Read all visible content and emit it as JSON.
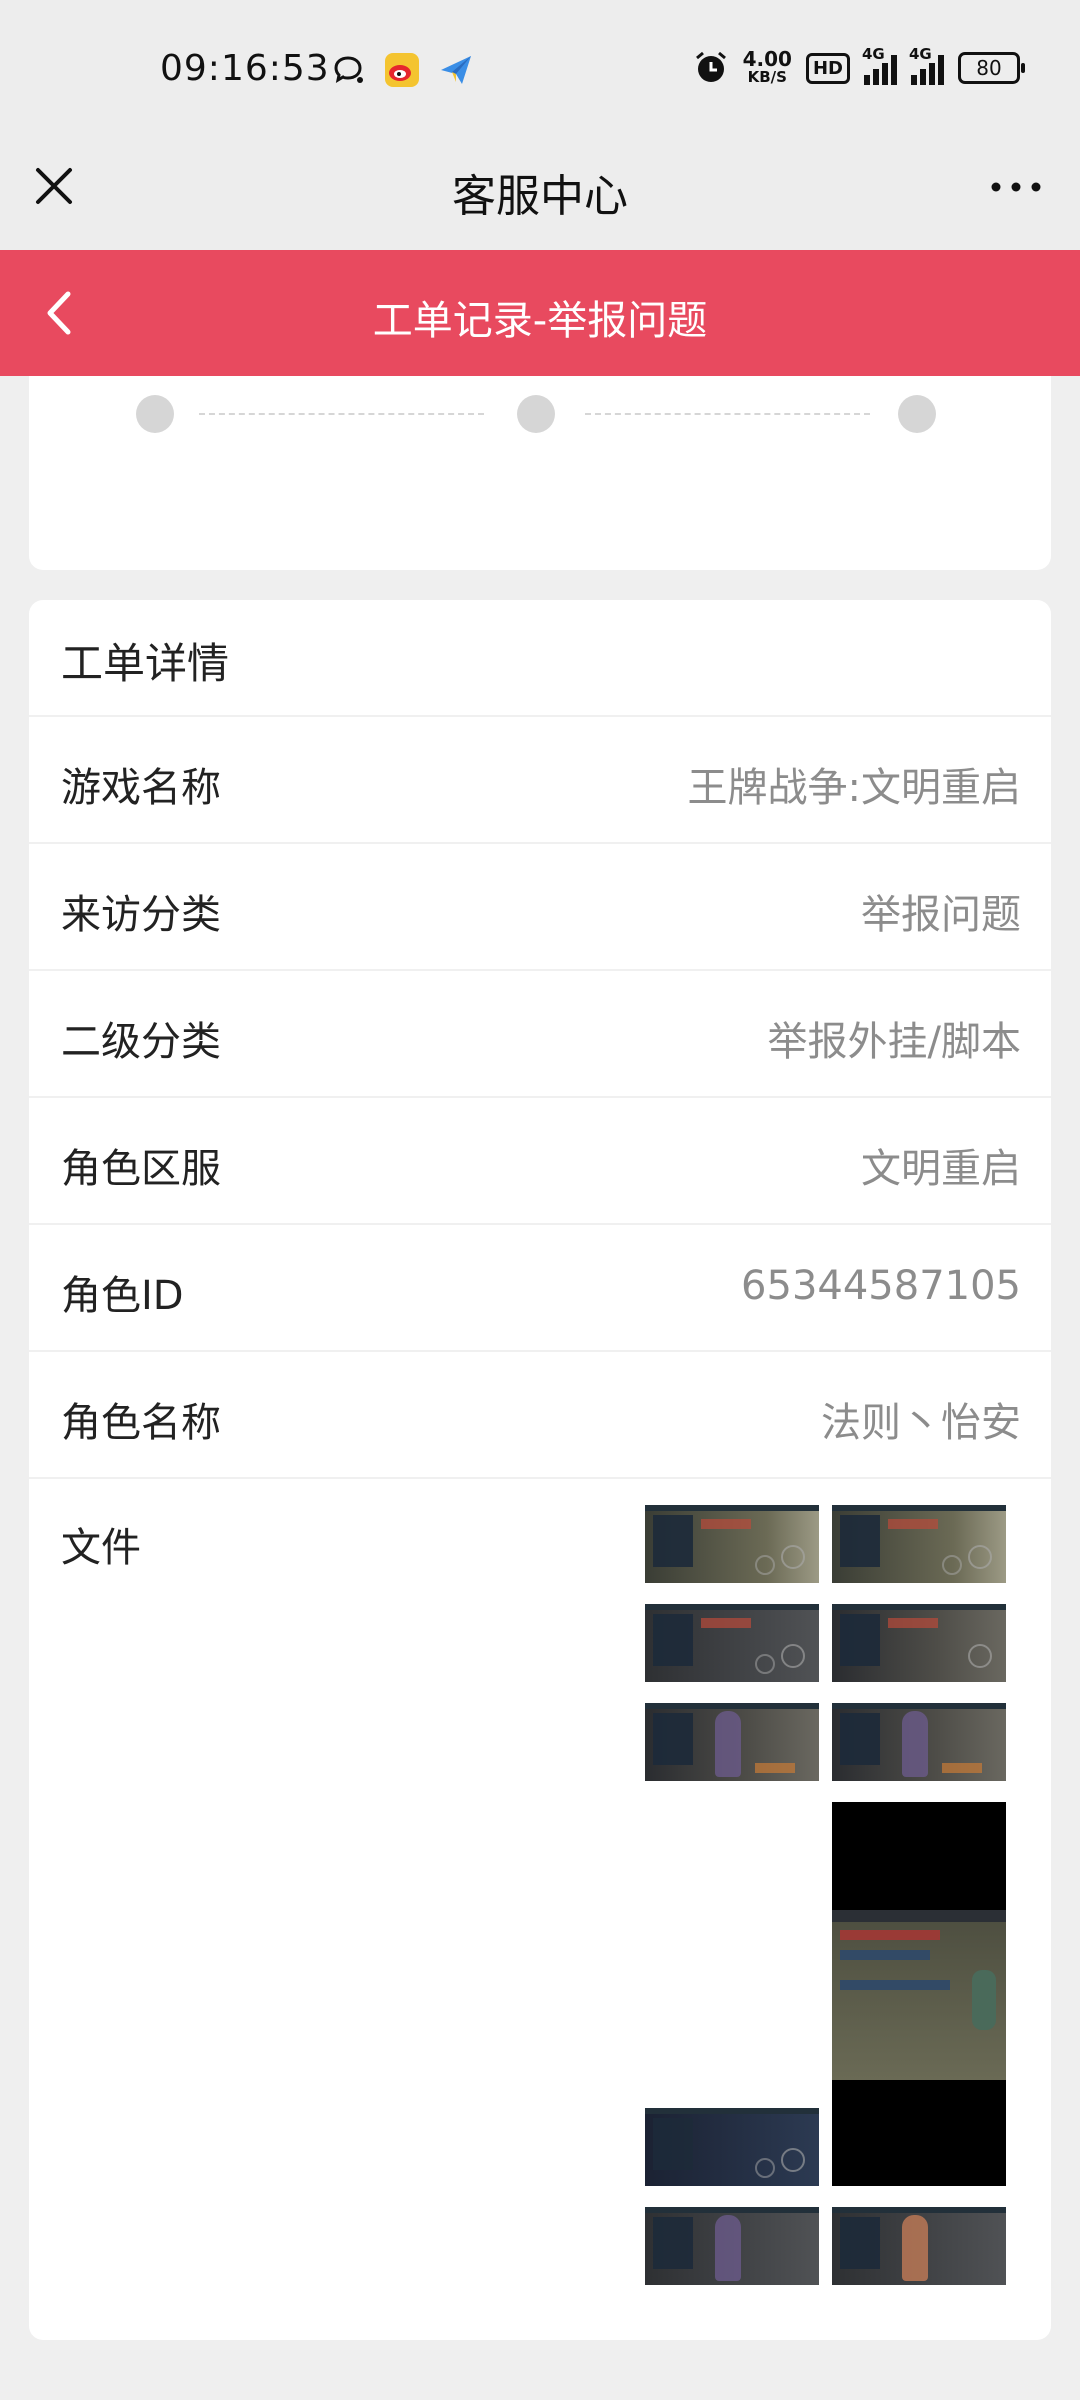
{
  "status_bar": {
    "time": "09:16:53",
    "net_speed_value": "4.00",
    "net_speed_unit": "KB/S",
    "hd_label": "HD",
    "signal_1_label": "4G",
    "signal_2_label": "4G",
    "battery": "80",
    "left_icons": [
      "chat-bubble-icon",
      "weibo-icon",
      "paper-plane-icon"
    ],
    "right_icons": [
      "alarm-icon",
      "hd-icon",
      "signal-icon",
      "signal-icon",
      "battery-icon"
    ]
  },
  "nav": {
    "title": "客服中心",
    "close_icon": "close-icon",
    "more_icon": "more-icon"
  },
  "header": {
    "title": "工单记录-举报问题",
    "back_icon": "chevron-left-icon",
    "accent_color": "#e84a5f"
  },
  "detail": {
    "heading": "工单详情",
    "rows": [
      {
        "label": "游戏名称",
        "value": "王牌战争:文明重启"
      },
      {
        "label": "来访分类",
        "value": "举报问题"
      },
      {
        "label": "二级分类",
        "value": "举报外挂/脚本"
      },
      {
        "label": "角色区服",
        "value": "文明重启"
      },
      {
        "label": "角色ID",
        "value": "65344587105"
      },
      {
        "label": "角色名称",
        "value": "法则丶怡安"
      }
    ],
    "files_label": "文件"
  }
}
